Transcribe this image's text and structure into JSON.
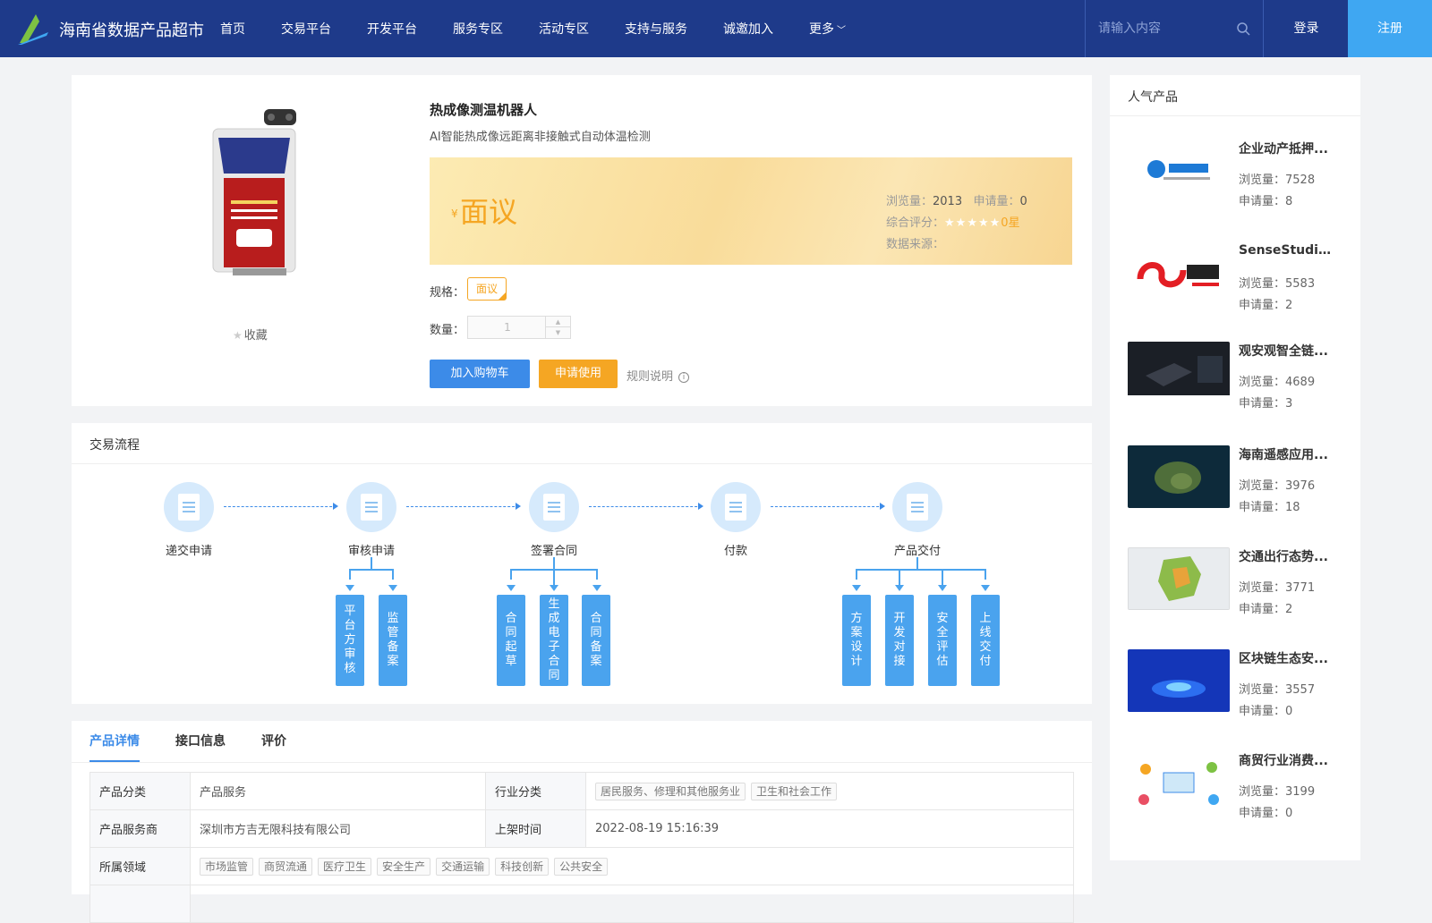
{
  "header": {
    "site_title": "海南省数据产品超市",
    "nav": [
      "首页",
      "交易平台",
      "开发平台",
      "服务专区",
      "活动专区",
      "支持与服务",
      "诚邀加入",
      "更多"
    ],
    "search_placeholder": "请输入内容",
    "login": "登录",
    "register": "注册"
  },
  "product": {
    "title": "热成像测温机器人",
    "subtitle": "AI智能热成像远距离非接触式自动体温检测",
    "favorite": "收藏",
    "price_symbol": "¥",
    "price": "面议",
    "views_label": "浏览量：",
    "views": "2013",
    "applies_label": "申请量：",
    "applies": "0",
    "rating_label": "综合评分：",
    "rating_text": "0星",
    "rating_value": 0,
    "source_label": "数据来源：",
    "spec_label": "规格：",
    "spec_value": "面议",
    "qty_label": "数量：",
    "qty_value": "1",
    "add_cart": "加入购物车",
    "apply": "申请使用",
    "rules": "规则说明"
  },
  "flow": {
    "title": "交易流程",
    "steps": [
      "递交申请",
      "审核申请",
      "签署合同",
      "付款",
      "产品交付"
    ],
    "sub_review": [
      "平台方审核",
      "监管备案"
    ],
    "sub_contract": [
      "合同起草",
      "生成电子合同",
      "合同备案"
    ],
    "sub_delivery": [
      "方案设计",
      "开发对接",
      "安全评估",
      "上线交付"
    ]
  },
  "detail": {
    "tabs": [
      "产品详情",
      "接口信息",
      "评价"
    ],
    "rows": {
      "category_k": "产品分类",
      "category_v": "产品服务",
      "industry_k": "行业分类",
      "industry_tags": [
        "居民服务、修理和其他服务业",
        "卫生和社会工作"
      ],
      "provider_k": "产品服务商",
      "provider_v": "深圳市方吉无限科技有限公司",
      "listed_k": "上架时间",
      "listed_v": "2022-08-19 15:16:39",
      "domain_k": "所属领域",
      "domain_tags": [
        "市场监管",
        "商贸流通",
        "医疗卫生",
        "安全生产",
        "交通运输",
        "科技创新",
        "公共安全"
      ]
    }
  },
  "sidebar": {
    "title": "人气产品",
    "items": [
      {
        "name": "企业动产抵押...",
        "views": "浏览量：7528",
        "applies": "申请量：8"
      },
      {
        "name": "SenseStudio...",
        "views": "浏览量：5583",
        "applies": "申请量：2"
      },
      {
        "name": "观安观智全链...",
        "views": "浏览量：4689",
        "applies": "申请量：3"
      },
      {
        "name": "海南遥感应用...",
        "views": "浏览量：3976",
        "applies": "申请量：18"
      },
      {
        "name": "交通出行态势...",
        "views": "浏览量：3771",
        "applies": "申请量：2"
      },
      {
        "name": "区块链生态安...",
        "views": "浏览量：3557",
        "applies": "申请量：0"
      },
      {
        "name": "商贸行业消费...",
        "views": "浏览量：3199",
        "applies": "申请量：0"
      }
    ]
  },
  "colors": {
    "header": "#1e3a8a",
    "primary": "#3c8be8",
    "accent": "#f5a623",
    "register": "#3fa7f2"
  }
}
